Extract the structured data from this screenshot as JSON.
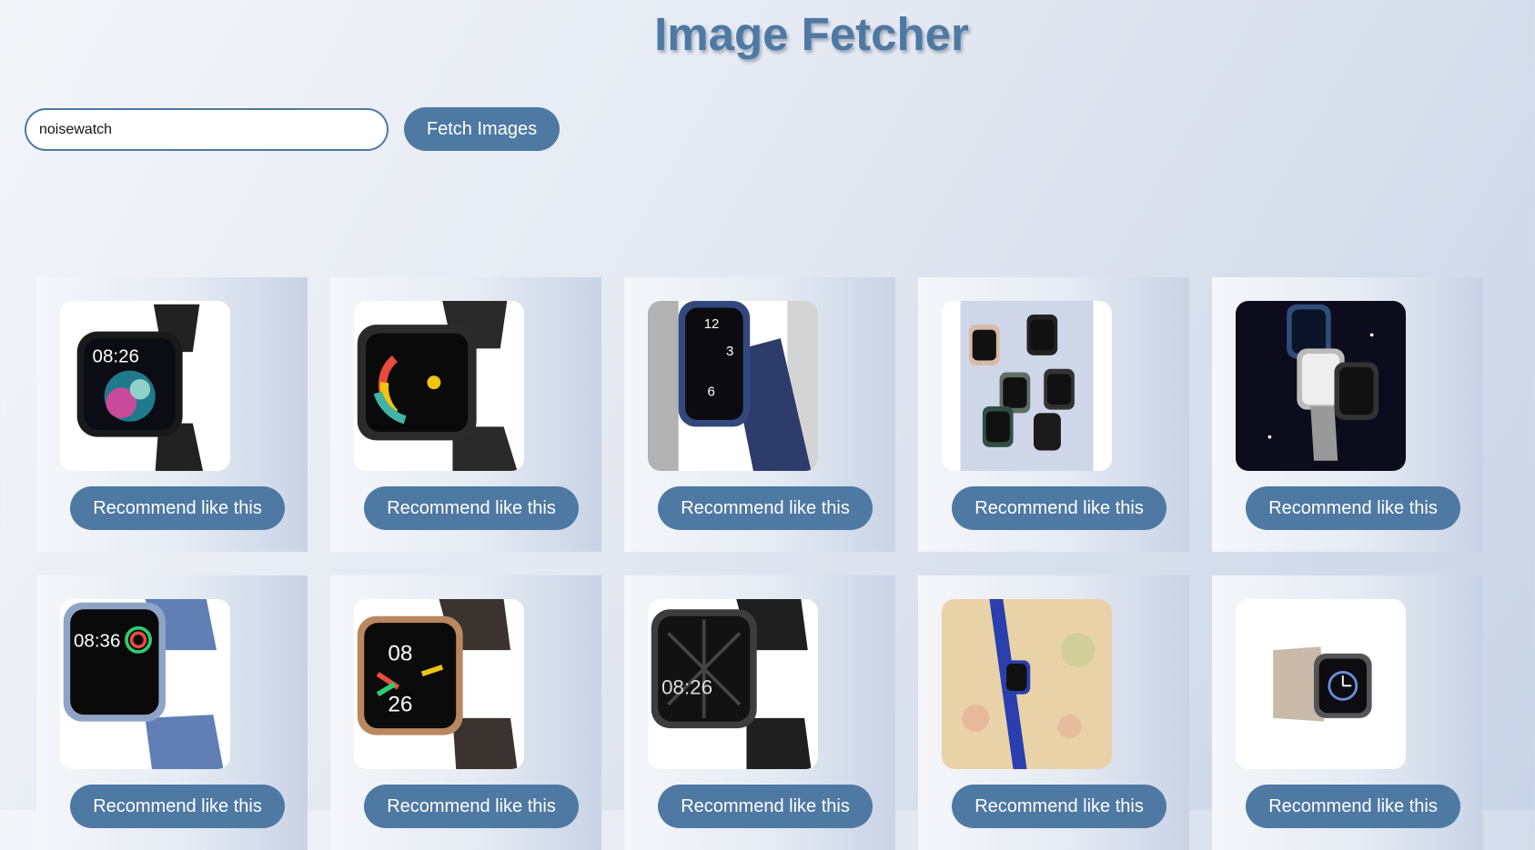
{
  "header": {
    "title": "Image Fetcher"
  },
  "search": {
    "value": "noisewatch",
    "button_label": "Fetch Images"
  },
  "results": [
    {
      "alt": "noise smartwatch black with colorful face",
      "button_label": "Recommend like this"
    },
    {
      "alt": "noise smartwatch black with ring dial",
      "button_label": "Recommend like this"
    },
    {
      "alt": "noise smartwatch navy blue strap",
      "button_label": "Recommend like this"
    },
    {
      "alt": "group of noise smartwatches",
      "button_label": "Recommend like this"
    },
    {
      "alt": "three smartwatches on dark background",
      "button_label": "Recommend like this"
    },
    {
      "alt": "noise smartwatch blue strap activity rings",
      "button_label": "Recommend like this"
    },
    {
      "alt": "noise smartwatch bronze with brown strap",
      "button_label": "Recommend like this"
    },
    {
      "alt": "noise smartwatch dark grey",
      "button_label": "Recommend like this"
    },
    {
      "alt": "smartwatch blue strap on floral background",
      "button_label": "Recommend like this"
    },
    {
      "alt": "smartwatch beige strap",
      "button_label": "Recommend like this"
    }
  ]
}
